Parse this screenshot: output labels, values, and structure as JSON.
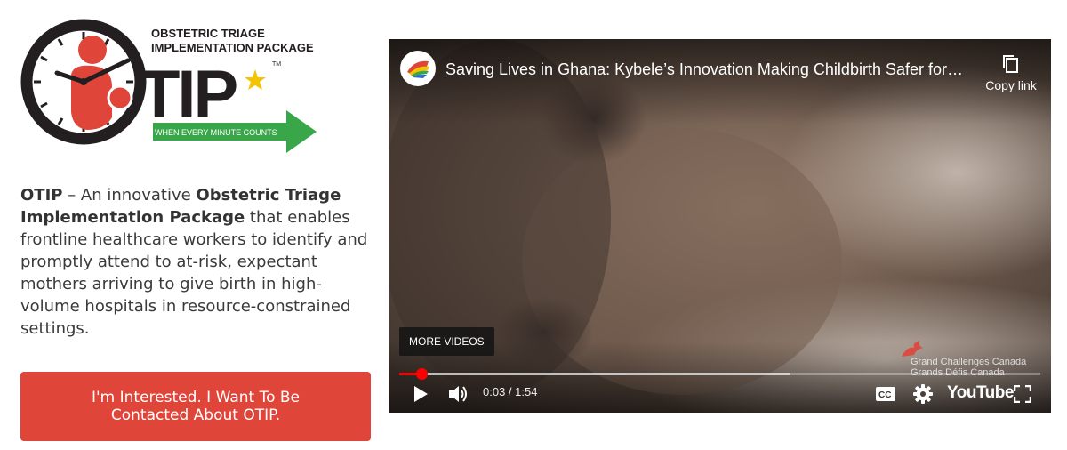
{
  "logo": {
    "line1": "OBSTETRIC TRIAGE",
    "line2": "IMPLEMENTATION PACKAGE",
    "acronym_suffix": "TIP",
    "tm": "TM",
    "tagline": "WHEN EVERY MINUTE COUNTS",
    "colors": {
      "red": "#e0453a",
      "dark": "#231f20",
      "green": "#3aa64a",
      "star": "#f5c400"
    }
  },
  "description": {
    "acronym": "OTIP",
    "dash": " – An innovative ",
    "full_name": "Obstetric Triage Implementation Package",
    "rest": " that enables frontline healthcare workers to identify and promptly attend to at-risk, expectant mothers arriving to give birth in high-volume hospitals in resource-constrained settings."
  },
  "cta": {
    "label": "I'm Interested. I Want To Be Contacted About OTIP.",
    "color": "#e0453a"
  },
  "video": {
    "title": "Saving Lives in Ghana: Kybele’s Innovation Making Childbirth Safer for…",
    "copy_link_label": "Copy link",
    "more_videos_label": "MORE VIDEOS",
    "watermark_line1": "Grand Challenges Canada",
    "watermark_line2": "Grands Défis Canada",
    "time_current": "0:03",
    "time_separator": " / ",
    "time_total": "1:54",
    "progress_played_fraction": 0.034,
    "progress_loaded_fraction": 0.61,
    "youtube_label": "YouTube",
    "icons": [
      "play-icon",
      "volume-icon",
      "captions-icon",
      "settings-icon",
      "fullscreen-icon",
      "copy-icon"
    ]
  }
}
